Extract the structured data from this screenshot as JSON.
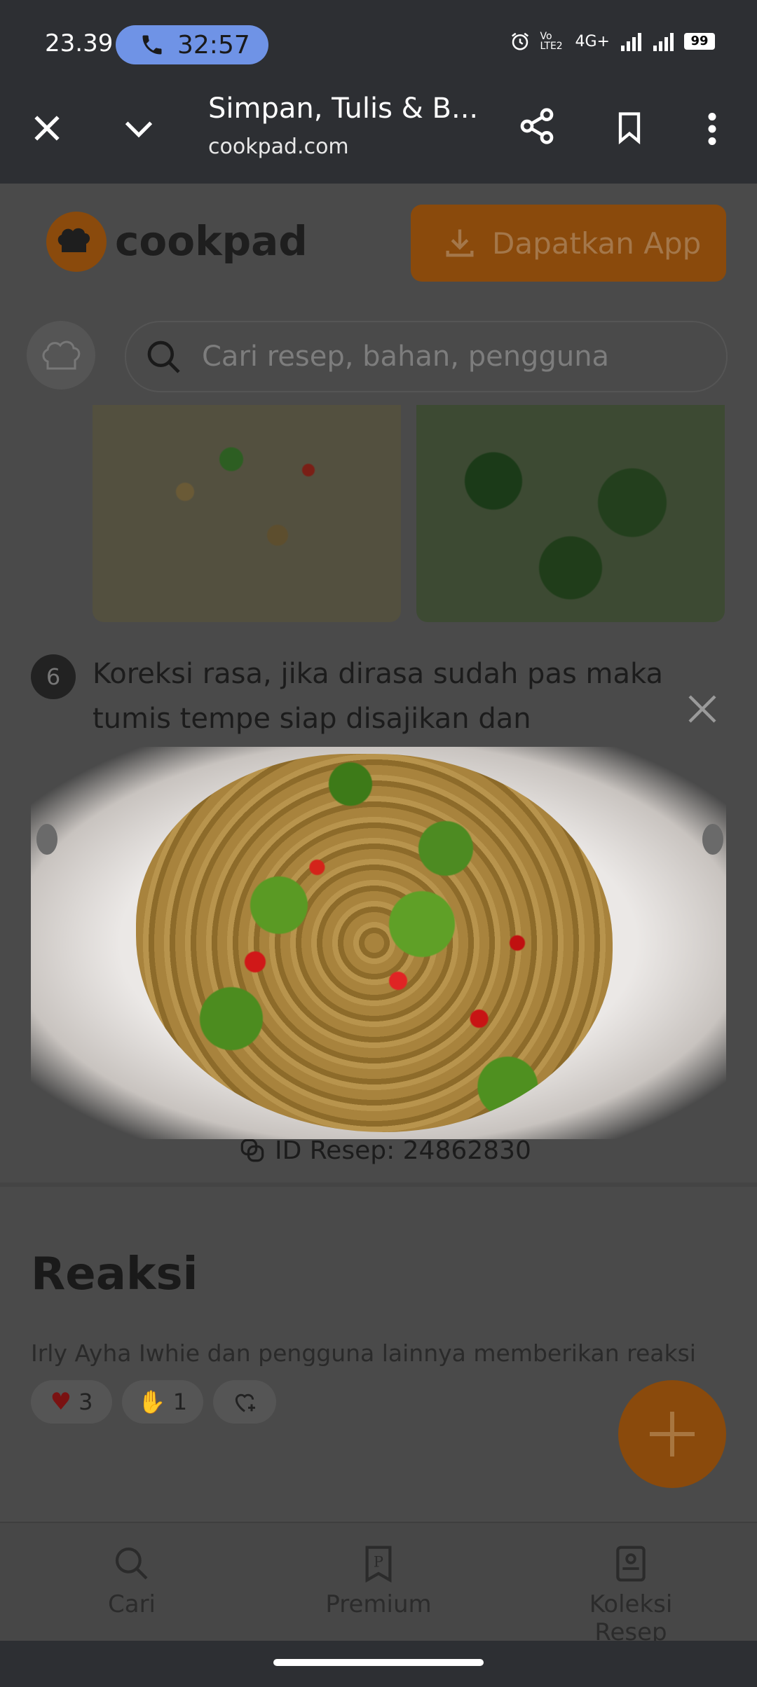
{
  "status_bar": {
    "time": "23.39",
    "call_duration": "32:57",
    "network": "4G+",
    "volte": "Vo LTE2",
    "battery": "99"
  },
  "browser": {
    "title": "Simpan, Tulis & B...",
    "url": "cookpad.com"
  },
  "site_header": {
    "logo_text": "cookpad",
    "app_button_label": "Dapatkan App",
    "search_placeholder": "Cari resep, bahan, pengguna"
  },
  "step": {
    "number": "6",
    "text": "Koreksi rasa, jika dirasa sudah pas maka tumis tempe siap disajikan dan dinikmati."
  },
  "recipe_id": {
    "label": "ID Resep: 24862830"
  },
  "reactions": {
    "title": "Reaksi",
    "description": "Irly Ayha Iwhie dan pengguna lainnya memberikan reaksi",
    "heart_count": "3",
    "clap_count": "1"
  },
  "bottom_nav": {
    "search_label": "Cari",
    "premium_label": "Premium",
    "collection_label": "Koleksi Resep"
  },
  "colors": {
    "brand_orange": "#FF9933",
    "call_pill": "#6f93e6",
    "system_bar": "#2d2f33"
  }
}
